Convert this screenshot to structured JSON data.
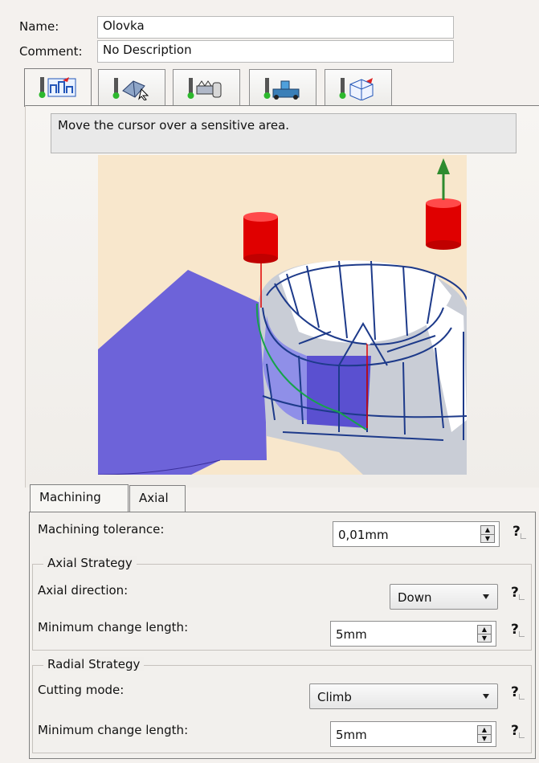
{
  "header": {
    "name_label": "Name:",
    "name_value": "Olovka",
    "comment_label": "Comment:",
    "comment_value": "No Description"
  },
  "top_tabs": [
    {
      "icon": "strategy-icon",
      "active": true
    },
    {
      "icon": "geometry-icon"
    },
    {
      "icon": "tool-icon"
    },
    {
      "icon": "feeds-speeds-icon"
    },
    {
      "icon": "macros-icon"
    }
  ],
  "message": "Move the cursor over a sensitive area.",
  "bottom_tabs": [
    "Machining",
    "Axial"
  ],
  "machining": {
    "tolerance_label": "Machining tolerance:",
    "tolerance_value": "0,01mm",
    "axial_group": "Axial Strategy",
    "axial_direction_label": "Axial direction:",
    "axial_direction_value": "Down",
    "axial_min_change_label": "Minimum change length:",
    "axial_min_change_value": "5mm",
    "radial_group": "Radial Strategy",
    "cutting_mode_label": "Cutting mode:",
    "cutting_mode_value": "Climb",
    "radial_min_change_label": "Minimum change length:",
    "radial_min_change_value": "5mm",
    "help_symbol": "?"
  },
  "colors": {
    "viewport_bg": "#f8e7cc",
    "surface_blue": "#6d63d9",
    "wire_blue": "#1d3a8a",
    "cylinder_red": "#e00000",
    "arrow_green": "#2e8b2e"
  }
}
